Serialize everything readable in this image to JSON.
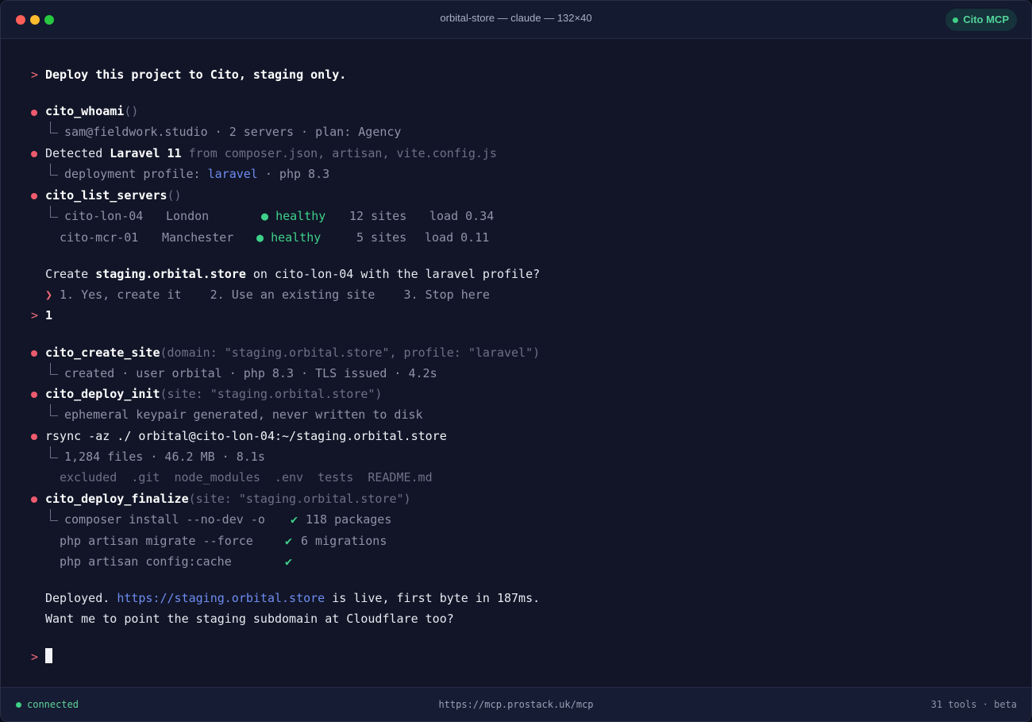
{
  "window": {
    "title": "orbital-store — claude — 132×40",
    "badge": "Cito MCP"
  },
  "prompt_symbol": ">",
  "user_message": "Deploy this project to Cito, staging only.",
  "whoami": {
    "fn": "cito_whoami",
    "parens": "()",
    "result": "sam@fieldwork.studio · 2 servers · plan: Agency"
  },
  "detected": {
    "prefix": "Detected ",
    "framework": "Laravel 11",
    "sources": " from composer.json, artisan, vite.config.js",
    "profile_prefix": "deployment profile: ",
    "profile": "laravel",
    "profile_suffix": " · php 8.3"
  },
  "list_servers": {
    "fn": "cito_list_servers",
    "parens": "()",
    "servers": [
      {
        "name": "cito-lon-04",
        "city": "London",
        "status": "healthy",
        "sites": "12 sites",
        "load": "load 0.34"
      },
      {
        "name": "cito-mcr-01",
        "city": "Manchester",
        "status": "healthy",
        "sites": "5 sites",
        "load": "load 0.11"
      }
    ]
  },
  "question": {
    "pre": "Create ",
    "domain": "staging.orbital.store",
    "post": " on cito-lon-04 with the laravel profile?",
    "selector": "❯",
    "options": "1. Yes, create it    2. Use an existing site    3. Stop here",
    "answer": "1"
  },
  "create_site": {
    "fn": "cito_create_site",
    "args": "(domain: \"staging.orbital.store\", profile: \"laravel\")",
    "result": "created · user orbital · php 8.3 · TLS issued · 4.2s"
  },
  "deploy_init": {
    "fn": "cito_deploy_init",
    "args": "(site: \"staging.orbital.store\")",
    "result": "ephemeral keypair generated, never written to disk"
  },
  "rsync": {
    "cmd": "rsync -az ./ orbital@cito-lon-04:~/staging.orbital.store",
    "result": "1,284 files · 46.2 MB · 8.1s",
    "excluded_label": "excluded",
    "excluded": ".git  node_modules  .env  tests  README.md"
  },
  "finalize": {
    "fn": "cito_deploy_finalize",
    "args": "(site: \"staging.orbital.store\")",
    "steps": [
      {
        "cmd": "composer install --no-dev -o",
        "check": "✔",
        "note": "118 packages"
      },
      {
        "cmd": "php artisan migrate --force",
        "check": "✔",
        "note": "6 migrations"
      },
      {
        "cmd": "php artisan config:cache",
        "check": "✔",
        "note": ""
      }
    ]
  },
  "summary": {
    "pre": "Deployed. ",
    "url": "https://staging.orbital.store",
    "post": " is live, first byte in 187ms.",
    "line2": "Want me to point the staging subdomain at Cloudflare too?"
  },
  "statusbar": {
    "status": "connected",
    "endpoint": "https://mcp.prostack.uk/mcp",
    "info": "31 tools · beta"
  },
  "colors": {
    "accent_red": "#ee5b6e",
    "success_green": "#3fd08a",
    "link_blue": "#6f8cf2",
    "background": "#111527"
  }
}
